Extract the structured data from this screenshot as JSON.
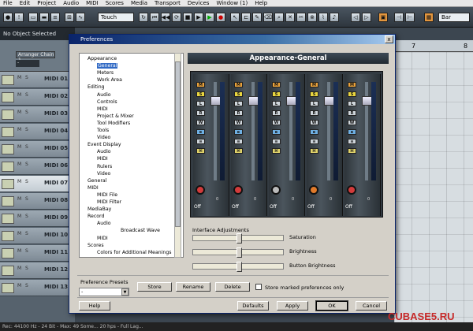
{
  "menubar": {
    "items": [
      "File",
      "Edit",
      "Project",
      "Audio",
      "MIDI",
      "Scores",
      "Media",
      "Transport",
      "Devices",
      "Window (1)",
      "Help"
    ]
  },
  "toolbar": {
    "tool_mode": "Touch",
    "right_label": "Bar"
  },
  "selection_info": "No Object Selected",
  "inspector": {
    "chain_label": "Arranger Chain 1",
    "chain_value": "-"
  },
  "ruler": {
    "marks": [
      "7",
      "8"
    ]
  },
  "tracks": [
    {
      "name": "MIDI 01"
    },
    {
      "name": "MIDI 02"
    },
    {
      "name": "MIDI 03"
    },
    {
      "name": "MIDI 04"
    },
    {
      "name": "MIDI 05"
    },
    {
      "name": "MIDI 06"
    },
    {
      "name": "MIDI 07",
      "selected": true
    },
    {
      "name": "MIDI 08"
    },
    {
      "name": "MIDI 09"
    },
    {
      "name": "MIDI 10"
    },
    {
      "name": "MIDI 11"
    },
    {
      "name": "MIDI 12"
    },
    {
      "name": "MIDI 13"
    }
  ],
  "track_ms": {
    "m": "M",
    "s": "S"
  },
  "dialog": {
    "title": "Preferences",
    "close_glyph": "x",
    "panel_title": "Appearance-General",
    "tree": [
      {
        "label": "Appearance",
        "level": 0
      },
      {
        "label": "General",
        "level": 1,
        "selected": true
      },
      {
        "label": "Meters",
        "level": 1
      },
      {
        "label": "Work Area",
        "level": 1
      },
      {
        "label": "Editing",
        "level": 0
      },
      {
        "label": "Audio",
        "level": 1
      },
      {
        "label": "Controls",
        "level": 1
      },
      {
        "label": "MIDI",
        "level": 1
      },
      {
        "label": "Project & Mixer",
        "level": 1
      },
      {
        "label": "Tool Modifiers",
        "level": 1
      },
      {
        "label": "Tools",
        "level": 1
      },
      {
        "label": "Video",
        "level": 1
      },
      {
        "label": "Event Display",
        "level": 0
      },
      {
        "label": "Audio",
        "level": 1
      },
      {
        "label": "MIDI",
        "level": 1
      },
      {
        "label": "Rulers",
        "level": 1
      },
      {
        "label": "Video",
        "level": 1
      },
      {
        "label": "General",
        "level": 0
      },
      {
        "label": "MIDI",
        "level": 0
      },
      {
        "label": "MIDI File",
        "level": 1
      },
      {
        "label": "MIDI Filter",
        "level": 1
      },
      {
        "label": "MediaBay",
        "level": 0
      },
      {
        "label": "Record",
        "level": 0
      },
      {
        "label": "Audio",
        "level": 1
      },
      {
        "label": "Broadcast Wave",
        "level": 2
      },
      {
        "label": "MIDI",
        "level": 1
      },
      {
        "label": "Scores",
        "level": 0
      },
      {
        "label": "Colors for Additional Meanings",
        "level": 1
      }
    ],
    "mixer_strips": [
      {
        "buttons": [
          "M",
          "S",
          "L",
          "R",
          "W",
          "e",
          "≡",
          "⌘"
        ],
        "knob_color": "#d23b3b",
        "value": "0",
        "label": "Off"
      },
      {
        "buttons": [
          "M",
          "S",
          "L",
          "R",
          "W",
          "e",
          "≡",
          "⌘"
        ],
        "knob_color": "#d23b3b",
        "value": "0",
        "label": "Off"
      },
      {
        "buttons": [
          "M",
          "S",
          "L",
          "R",
          "W",
          "e",
          "≡",
          "⌘"
        ],
        "knob_color": "#bbbbbb",
        "value": "0",
        "label": "Off"
      },
      {
        "buttons": [
          "M",
          "S",
          "L",
          "R",
          "W",
          "e",
          "≡",
          "⌘"
        ],
        "knob_color": "#e07a2a",
        "value": "0",
        "label": "Off"
      },
      {
        "buttons": [
          "M",
          "S",
          "L",
          "R",
          "W",
          "e",
          "≡",
          "⌘"
        ],
        "knob_color": "#d23b3b",
        "value": "0",
        "label": "Off"
      }
    ],
    "interface_adjustments": {
      "label": "Interface Adjustments",
      "sliders": [
        {
          "name": "Saturation",
          "level": 0.5
        },
        {
          "name": "Brightness",
          "level": 0.5
        },
        {
          "name": "Button Brightness",
          "level": 0.5
        }
      ]
    },
    "presets": {
      "label": "Preference Presets",
      "value": "-",
      "store": "Store",
      "rename": "Rename",
      "delete": "Delete",
      "store_marked": "Store marked preferences only"
    },
    "buttons": {
      "help": "Help",
      "defaults": "Defaults",
      "apply": "Apply",
      "ok": "OK",
      "cancel": "Cancel"
    }
  },
  "statusbar": {
    "text": "Rec: 44100 Hz - 24 Bit - Max: 49 Some... 20 hps - Full Lag..."
  },
  "watermark": "CUBASE5.RU"
}
